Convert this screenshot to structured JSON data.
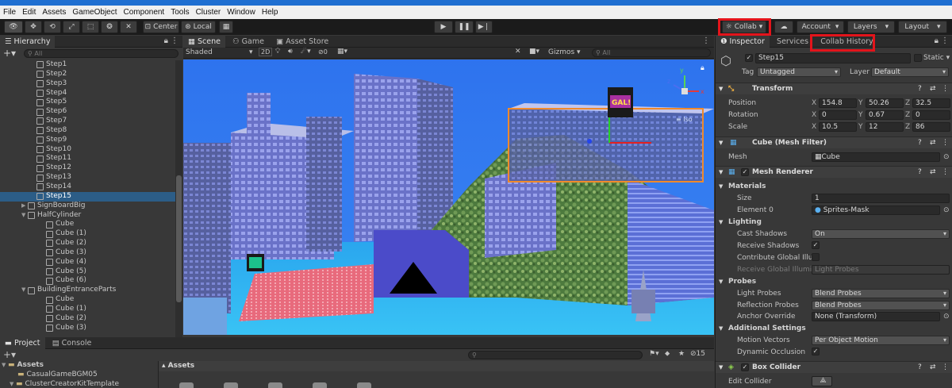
{
  "menu": [
    "File",
    "Edit",
    "Assets",
    "GameObject",
    "Component",
    "Tools",
    "Cluster",
    "Window",
    "Help"
  ],
  "toolbar": {
    "pivot_label": "Center",
    "space_label": "Local",
    "collab_label": "Collab",
    "account_label": "Account",
    "layers_label": "Layers",
    "layout_label": "Layout"
  },
  "hierarchy": {
    "tab": "Hierarchy",
    "search_placeholder": "All",
    "items": [
      {
        "label": "Step1",
        "indent": 2
      },
      {
        "label": "Step2",
        "indent": 2
      },
      {
        "label": "Step3",
        "indent": 2
      },
      {
        "label": "Step4",
        "indent": 2
      },
      {
        "label": "Step5",
        "indent": 2
      },
      {
        "label": "Step6",
        "indent": 2
      },
      {
        "label": "Step7",
        "indent": 2
      },
      {
        "label": "Step8",
        "indent": 2
      },
      {
        "label": "Step9",
        "indent": 2
      },
      {
        "label": "Step10",
        "indent": 2
      },
      {
        "label": "Step11",
        "indent": 2
      },
      {
        "label": "Step12",
        "indent": 2
      },
      {
        "label": "Step13",
        "indent": 2
      },
      {
        "label": "Step14",
        "indent": 2
      },
      {
        "label": "Step15",
        "indent": 2,
        "selected": true
      },
      {
        "label": "SignBoardBig",
        "indent": 1,
        "arrow": "▶"
      },
      {
        "label": "HalfCylinder",
        "indent": 1,
        "arrow": "▼"
      },
      {
        "label": "Cube",
        "indent": 3
      },
      {
        "label": "Cube (1)",
        "indent": 3
      },
      {
        "label": "Cube (2)",
        "indent": 3
      },
      {
        "label": "Cube (3)",
        "indent": 3
      },
      {
        "label": "Cube (4)",
        "indent": 3
      },
      {
        "label": "Cube (5)",
        "indent": 3
      },
      {
        "label": "Cube (6)",
        "indent": 3
      },
      {
        "label": "BuildingEntranceParts",
        "indent": 1,
        "arrow": "▼"
      },
      {
        "label": "Cube",
        "indent": 3
      },
      {
        "label": "Cube (1)",
        "indent": 3
      },
      {
        "label": "Cube (2)",
        "indent": 3
      },
      {
        "label": "Cube (3)",
        "indent": 3
      }
    ]
  },
  "scene": {
    "tabs": [
      "Scene",
      "Game",
      "Asset Store"
    ],
    "shading": "Shaded",
    "mode_2d": "2D",
    "fx_count": "0",
    "gizmos": "Gizmos",
    "search_placeholder": "All",
    "iso_label": "Iso",
    "sign_text": "GAL!"
  },
  "inspector": {
    "tabs": [
      "Inspector",
      "Services",
      "Collab History"
    ],
    "object_name": "Step15",
    "static_label": "Static",
    "tag_label": "Tag",
    "tag_value": "Untagged",
    "layer_label": "Layer",
    "layer_value": "Default",
    "transform": {
      "title": "Transform",
      "position_label": "Position",
      "rotation_label": "Rotation",
      "scale_label": "Scale",
      "position": [
        "154.8",
        "50.26",
        "32.5"
      ],
      "rotation": [
        "0",
        "0.67",
        "0"
      ],
      "scale": [
        "10.5",
        "12",
        "86"
      ]
    },
    "mesh_filter": {
      "title": "Cube (Mesh Filter)",
      "mesh_label": "Mesh",
      "mesh_value": "Cube"
    },
    "mesh_renderer": {
      "title": "Mesh Renderer",
      "materials_label": "Materials",
      "size_label": "Size",
      "size_value": "1",
      "element0_label": "Element 0",
      "element0_value": "Sprites-Mask",
      "lighting_label": "Lighting",
      "cast_shadows_label": "Cast Shadows",
      "cast_shadows_value": "On",
      "receive_shadows_label": "Receive Shadows",
      "contribute_gi_label": "Contribute Global Illum",
      "receive_gi_label": "Receive Global Illumin",
      "receive_gi_value": "Light Probes",
      "probes_label": "Probes",
      "light_probes_label": "Light Probes",
      "light_probes_value": "Blend Probes",
      "reflection_probes_label": "Reflection Probes",
      "reflection_probes_value": "Blend Probes",
      "anchor_override_label": "Anchor Override",
      "anchor_override_value": "None (Transform)",
      "additional_label": "Additional Settings",
      "motion_vectors_label": "Motion Vectors",
      "motion_vectors_value": "Per Object Motion",
      "dynamic_occlusion_label": "Dynamic Occlusion"
    },
    "box_collider": {
      "title": "Box Collider",
      "edit_label": "Edit Collider"
    }
  },
  "project": {
    "tabs": [
      "Project",
      "Console"
    ],
    "folders": [
      "Assets",
      "CasualGameBGM05",
      "ClusterCreatorKitTemplate"
    ],
    "breadcrumb": "Assets",
    "hidden_count": "15"
  },
  "colors": {
    "highlight": "#e3141b",
    "selection": "#2c5d87",
    "sky": "#2f76ef"
  }
}
